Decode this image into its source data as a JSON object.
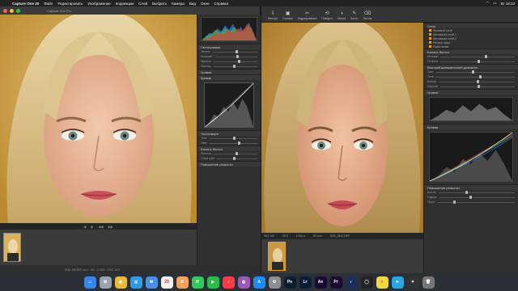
{
  "menubar": {
    "app_name": "Capture One 20",
    "items": [
      "Файл",
      "Редактировать",
      "Изображение",
      "Коррекции",
      "Слой",
      "Выбрать",
      "Камера",
      "Вид",
      "Окно",
      "Справка"
    ],
    "clock": "Вт 18:23"
  },
  "left_window": {
    "title": "Capture One Pro",
    "status_text": "Max 80/300 mm ∙ f/8 ∙ 1/160 ∙ ISO 100",
    "viewer_controls": [
      "◀",
      "▶",
      "◀◀",
      "▶▶"
    ],
    "tool_sections": [
      "Гистограмма",
      "Уровни",
      "Кривая",
      "Экспозиция",
      "Баланс белого",
      "Повышение резкости"
    ],
    "sliders": [
      {
        "label": "Экспоз.",
        "value": 0.5
      },
      {
        "label": "Контраст",
        "value": 0.5
      },
      {
        "label": "Яркость",
        "value": 0.55
      },
      {
        "label": "Насыщ.",
        "value": 0.45
      },
      {
        "label": "Тень",
        "value": 0.5
      },
      {
        "label": "Свет",
        "value": 0.6
      },
      {
        "label": "Ясность",
        "value": 0.5
      },
      {
        "label": "Структура",
        "value": 0.4
      }
    ]
  },
  "right_window": {
    "title": "Capture One — Сеанс",
    "toolbar": [
      {
        "icon": "⇩",
        "label": "Импорт"
      },
      {
        "icon": "▣",
        "label": "Съемка"
      },
      {
        "icon": "✂",
        "label": "Кадрирование"
      },
      {
        "icon": "⟲",
        "label": "Поворот"
      },
      {
        "icon": "◑",
        "label": "Маска"
      },
      {
        "icon": "✎",
        "label": "Кисть"
      },
      {
        "icon": "⌫",
        "label": "Ластик"
      }
    ],
    "viewer_bar": [
      "ISO 100",
      "f/8.0",
      "1/160 s",
      "50 mm",
      "IMG_2841.NEF"
    ],
    "film_caption": "IMG_2841.NEF",
    "layers_title": "Слои",
    "layers": [
      "Фоновый слой",
      "Автомаска слой 1",
      "Автомаска слой 2",
      "Ретушь кожи",
      "Осветление"
    ],
    "tool_sections": [
      "Баланс белого",
      "Высокий динамический диапазон",
      "Уровни",
      "Кривая",
      "Повышение резкости"
    ],
    "wb_sliders": [
      {
        "label": "Кельвин",
        "value": 0.6
      },
      {
        "label": "Оттенок",
        "value": 0.5
      }
    ],
    "hdr_sliders": [
      {
        "label": "Свет",
        "value": 0.45
      },
      {
        "label": "Тень",
        "value": 0.55
      },
      {
        "label": "Белый",
        "value": 0.5
      },
      {
        "label": "Черный",
        "value": 0.5
      }
    ],
    "sharp_sliders": [
      {
        "label": "Кол-во",
        "value": 0.35
      },
      {
        "label": "Радиус",
        "value": 0.4
      },
      {
        "label": "Порог",
        "value": 0.2
      }
    ]
  },
  "dock": [
    {
      "name": "finder",
      "color": "#3a86e8",
      "glyph": "☺"
    },
    {
      "name": "launchpad",
      "color": "#9aa3ad",
      "glyph": "⊞"
    },
    {
      "name": "chrome",
      "color": "#e8b93a",
      "glyph": "◉"
    },
    {
      "name": "safari",
      "color": "#2f9be8",
      "glyph": "◎"
    },
    {
      "name": "mail",
      "color": "#4a90e2",
      "glyph": "✉"
    },
    {
      "name": "calendar",
      "color": "#f2f2f2",
      "glyph": "23"
    },
    {
      "name": "photos",
      "color": "#f4a261",
      "glyph": "✿"
    },
    {
      "name": "messages",
      "color": "#34c759",
      "glyph": "✆"
    },
    {
      "name": "facetime",
      "color": "#30b94d",
      "glyph": "▶"
    },
    {
      "name": "music",
      "color": "#fc3c44",
      "glyph": "♪"
    },
    {
      "name": "podcasts",
      "color": "#9b59b6",
      "glyph": "◍"
    },
    {
      "name": "appstore",
      "color": "#1d8cf8",
      "glyph": "A"
    },
    {
      "name": "settings",
      "color": "#8e8e93",
      "glyph": "⚙"
    },
    {
      "name": "photoshop",
      "color": "#0b1e33",
      "glyph": "Ps"
    },
    {
      "name": "lightroom",
      "color": "#0b1e33",
      "glyph": "Lr"
    },
    {
      "name": "aftereffects",
      "color": "#1b0b33",
      "glyph": "Ae"
    },
    {
      "name": "premiere",
      "color": "#1a0b33",
      "glyph": "Pr"
    },
    {
      "name": "cinema4d",
      "color": "#1d2f5a",
      "glyph": "◐"
    },
    {
      "name": "captureone",
      "color": "#222",
      "glyph": "◯"
    },
    {
      "name": "notes",
      "color": "#f5d742",
      "glyph": "≡"
    },
    {
      "name": "telegram",
      "color": "#2ba5e0",
      "glyph": "➤"
    },
    {
      "name": "finalcut",
      "color": "#333",
      "glyph": "✦"
    },
    {
      "name": "trash",
      "color": "#777",
      "glyph": "🗑"
    }
  ]
}
